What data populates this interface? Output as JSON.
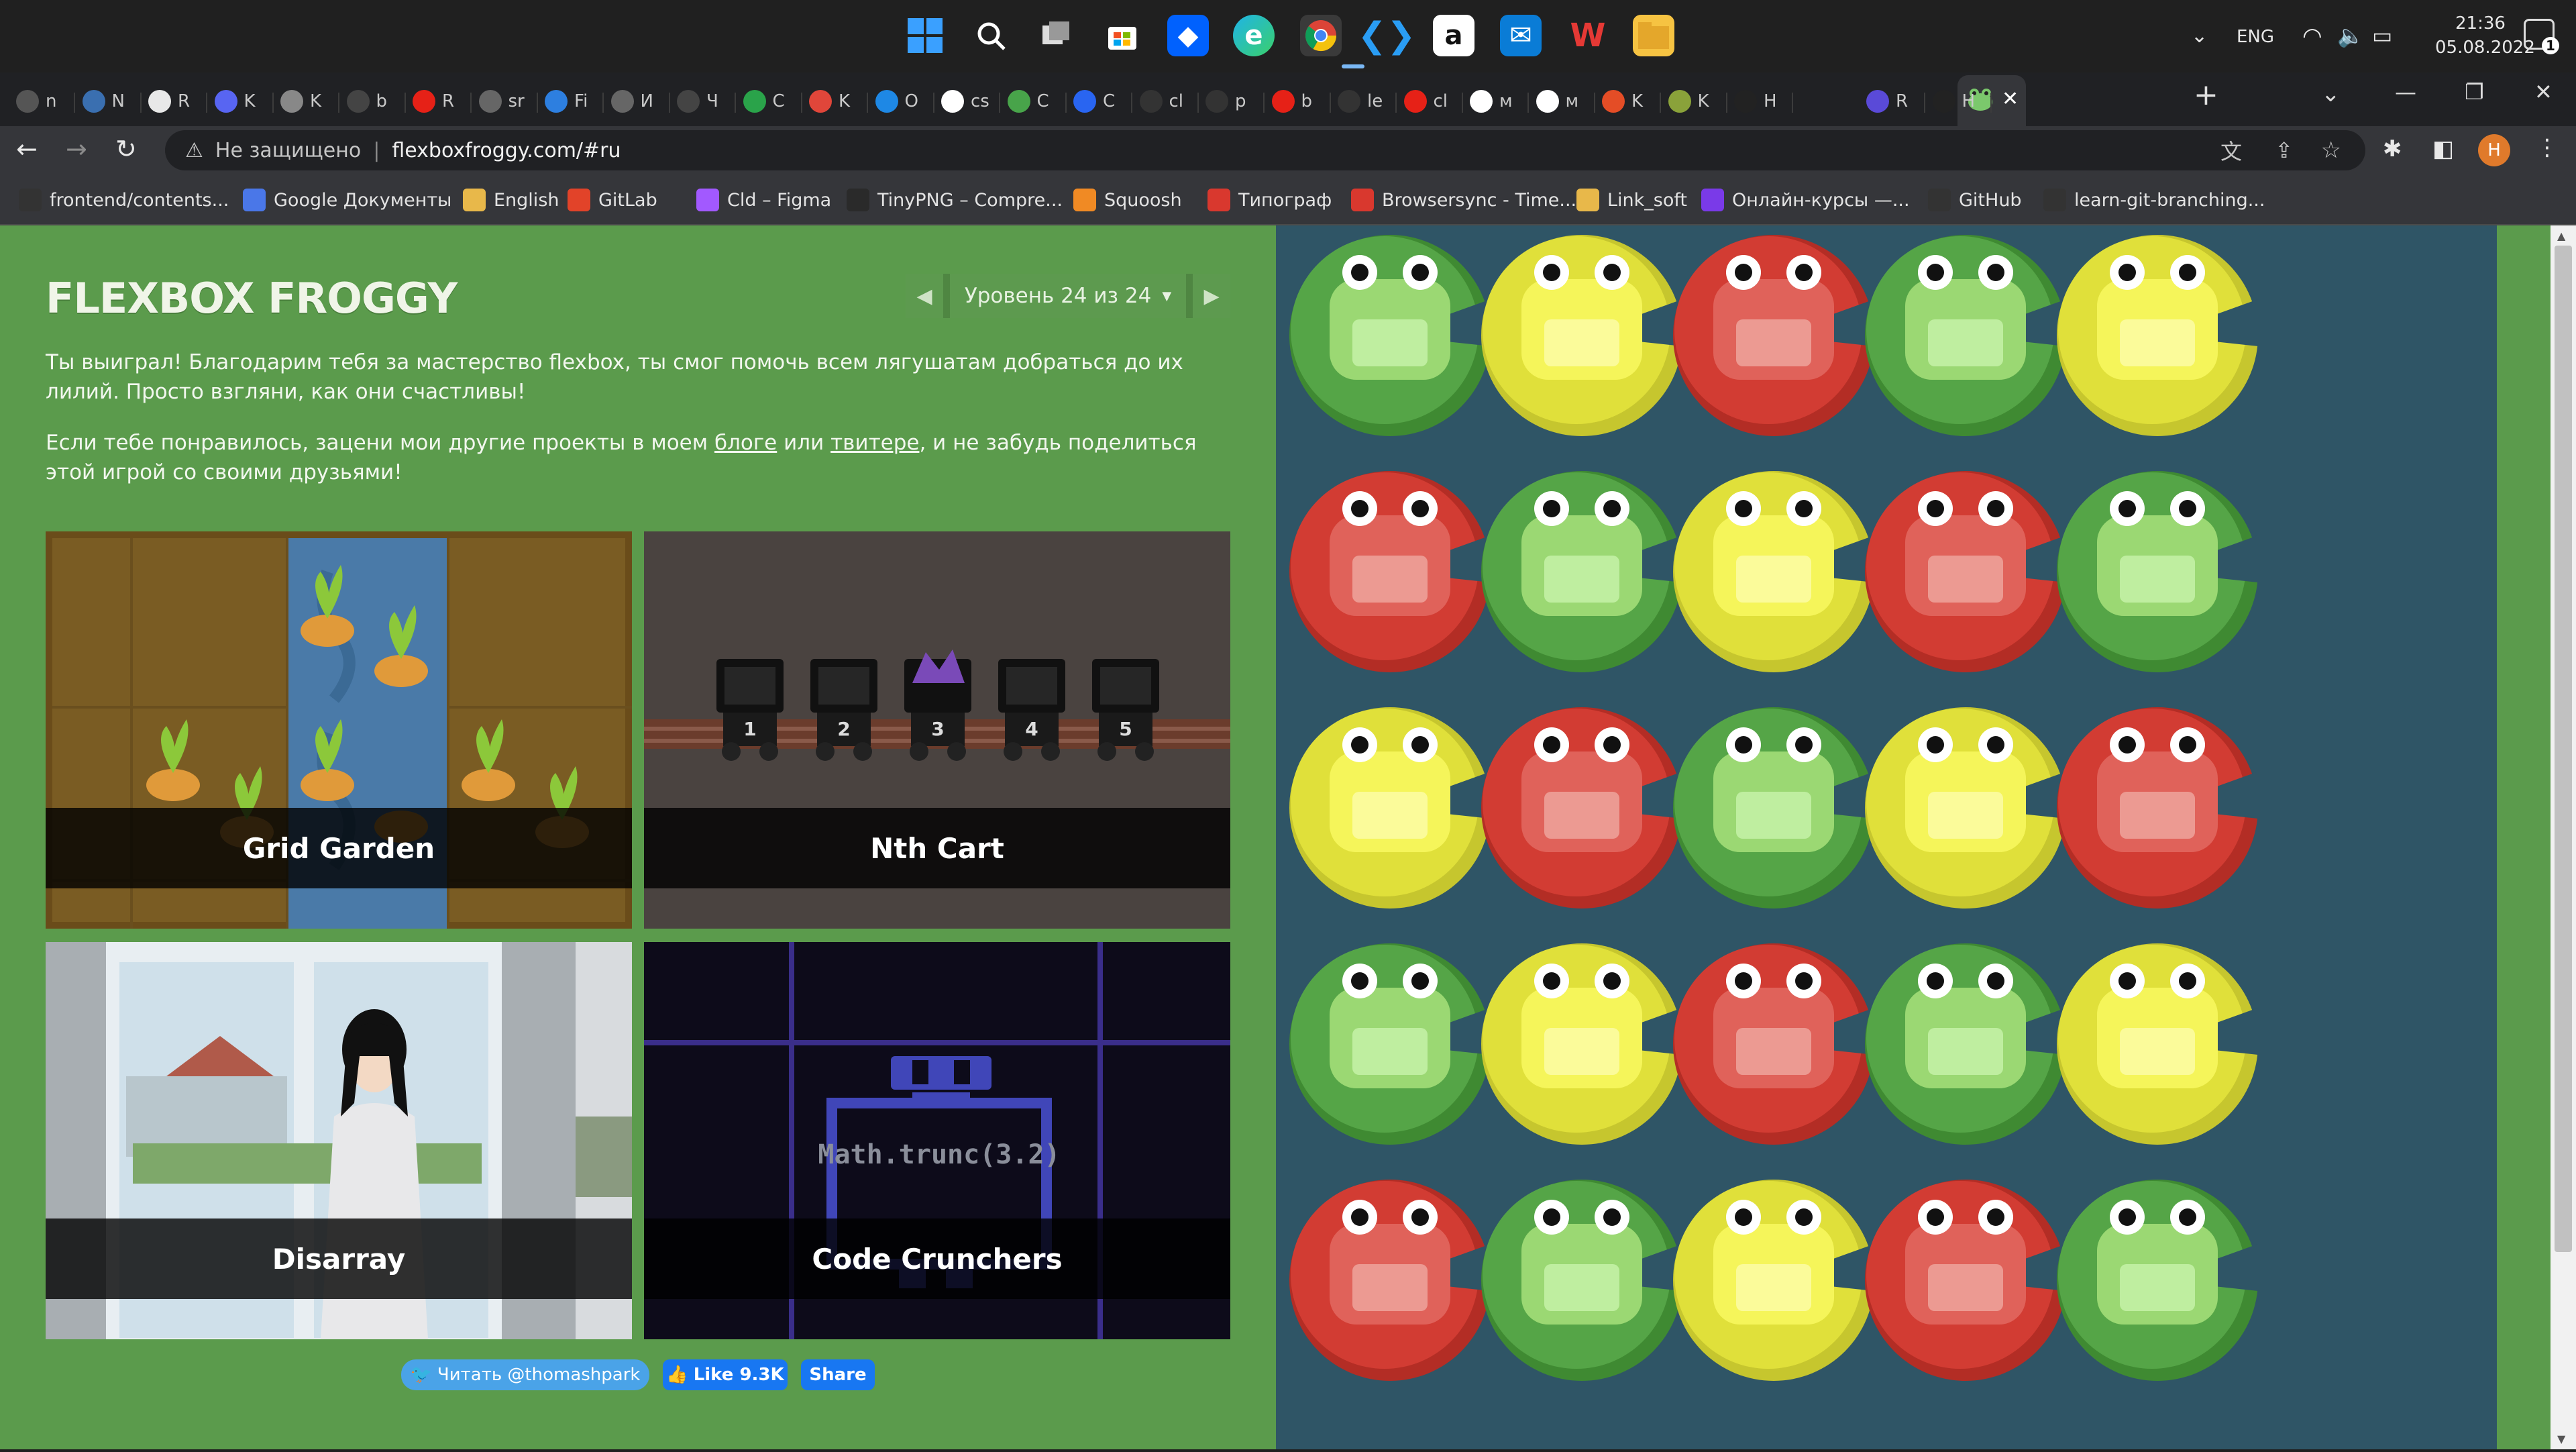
{
  "taskbar": {
    "icons": [
      "start-icon",
      "search-icon",
      "task-view-icon",
      "store-icon",
      "dropbox-icon",
      "edge-icon",
      "chrome-icon",
      "vscode-icon",
      "amazon-icon",
      "mail-icon",
      "office-icon",
      "explorer-icon"
    ],
    "language": "ENG",
    "time": "21:36",
    "date": "05.08.2022"
  },
  "tabs": {
    "items": [
      "n",
      "N",
      "R",
      "K",
      "K",
      "b",
      "R",
      "sr",
      "Fi",
      "И",
      "Ч",
      "C",
      "K",
      "O",
      "cs",
      "C",
      "C",
      "cl",
      "p",
      "b",
      "le",
      "cl",
      "м",
      "м",
      "K",
      "K",
      "H",
      "",
      "R",
      "H"
    ],
    "new_tab": "+"
  },
  "address": {
    "security": "Не защищено",
    "separator": "|",
    "url": "flexboxfroggy.com/#ru"
  },
  "bookmarks": [
    {
      "label": "frontend/contents..."
    },
    {
      "label": "Google Документы"
    },
    {
      "label": "English"
    },
    {
      "label": "GitLab"
    },
    {
      "label": "Cld – Figma"
    },
    {
      "label": "TinyPNG – Compre..."
    },
    {
      "label": "Squoosh"
    },
    {
      "label": "Типограф"
    },
    {
      "label": "Browsersync - Time..."
    },
    {
      "label": "Link_soft"
    },
    {
      "label": "Онлайн-курсы —..."
    },
    {
      "label": "GitHub"
    },
    {
      "label": "learn-git-branching..."
    }
  ],
  "game": {
    "title": "FLEXBOX FROGGY",
    "level_label": "Уровень 24 из 24",
    "level_caret": "▼",
    "win_text": "Ты выиграл! Благодарим тебя за мастерство flexbox, ты смог помочь всем лягушатам добраться до их лилий. Просто взгляни, как они счастливы!",
    "promo_before": "Если тебе понравилось, зацени мои другие проекты в моем ",
    "blog_link": "блоге",
    "promo_or": " или ",
    "twitter_link": "твитере",
    "promo_after": ", и не забудь поделиться этой игрой со своими друзьями!",
    "cards": [
      "Grid Garden",
      "Nth Cart",
      "Disarray",
      "Code Crunchers"
    ],
    "cart_numbers": [
      "1",
      "2",
      "3",
      "4",
      "5"
    ],
    "code_text": "Math.trunc(3.2)",
    "social": {
      "twitter": "Читать @thomashpark",
      "like": "Like 9.3K",
      "share": "Share"
    }
  },
  "avatar_letter": "H",
  "colors": {
    "green": "#5b9b4c",
    "board": "#2f5566",
    "frog_green": "#4a9a3a",
    "frog_yellow": "#d6d63a",
    "frog_red": "#c93a2f"
  },
  "board_grid": [
    [
      "green",
      "yellow",
      "red",
      "green",
      "yellow"
    ],
    [
      "red",
      "green",
      "yellow",
      "red",
      "green"
    ],
    [
      "yellow",
      "red",
      "green",
      "yellow",
      "red"
    ],
    [
      "green",
      "yellow",
      "red",
      "green",
      "yellow"
    ],
    [
      "red",
      "green",
      "yellow",
      "red",
      "green"
    ]
  ]
}
